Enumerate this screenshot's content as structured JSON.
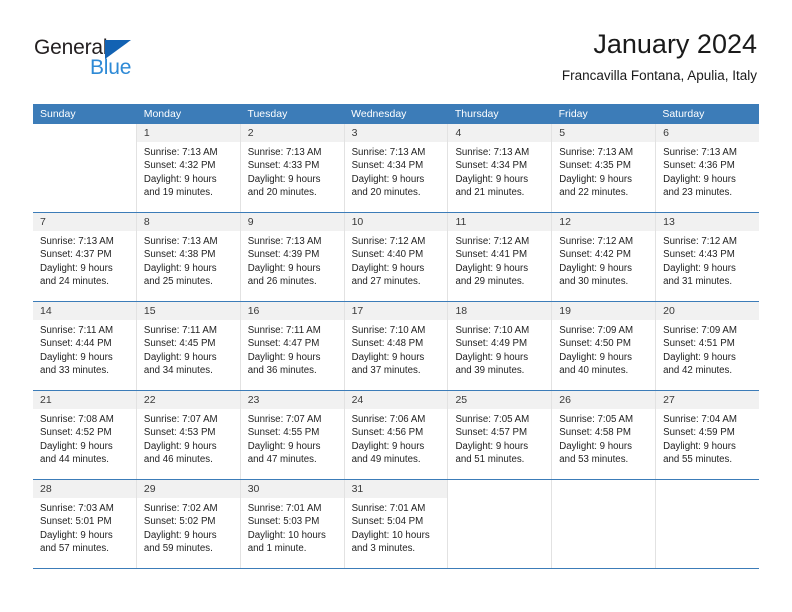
{
  "brand": {
    "name_part1": "General",
    "name_part2": "Blue",
    "triangle_color": "#1262b3",
    "blue_color": "#2e8ad6",
    "dark_color": "#231f20"
  },
  "header": {
    "title": "January 2024",
    "subtitle": "Francavilla Fontana, Apulia, Italy"
  },
  "theme": {
    "header_bar_color": "#3c7cb8",
    "daynum_band_color": "#f1f1f1",
    "cell_border_color": "#e2e2e2"
  },
  "weekdays": [
    "Sunday",
    "Monday",
    "Tuesday",
    "Wednesday",
    "Thursday",
    "Friday",
    "Saturday"
  ],
  "weeks": [
    [
      {
        "day": "",
        "sunrise": "",
        "sunset": "",
        "daylight1": "",
        "daylight2": ""
      },
      {
        "day": "1",
        "sunrise": "Sunrise: 7:13 AM",
        "sunset": "Sunset: 4:32 PM",
        "daylight1": "Daylight: 9 hours",
        "daylight2": "and 19 minutes."
      },
      {
        "day": "2",
        "sunrise": "Sunrise: 7:13 AM",
        "sunset": "Sunset: 4:33 PM",
        "daylight1": "Daylight: 9 hours",
        "daylight2": "and 20 minutes."
      },
      {
        "day": "3",
        "sunrise": "Sunrise: 7:13 AM",
        "sunset": "Sunset: 4:34 PM",
        "daylight1": "Daylight: 9 hours",
        "daylight2": "and 20 minutes."
      },
      {
        "day": "4",
        "sunrise": "Sunrise: 7:13 AM",
        "sunset": "Sunset: 4:34 PM",
        "daylight1": "Daylight: 9 hours",
        "daylight2": "and 21 minutes."
      },
      {
        "day": "5",
        "sunrise": "Sunrise: 7:13 AM",
        "sunset": "Sunset: 4:35 PM",
        "daylight1": "Daylight: 9 hours",
        "daylight2": "and 22 minutes."
      },
      {
        "day": "6",
        "sunrise": "Sunrise: 7:13 AM",
        "sunset": "Sunset: 4:36 PM",
        "daylight1": "Daylight: 9 hours",
        "daylight2": "and 23 minutes."
      }
    ],
    [
      {
        "day": "7",
        "sunrise": "Sunrise: 7:13 AM",
        "sunset": "Sunset: 4:37 PM",
        "daylight1": "Daylight: 9 hours",
        "daylight2": "and 24 minutes."
      },
      {
        "day": "8",
        "sunrise": "Sunrise: 7:13 AM",
        "sunset": "Sunset: 4:38 PM",
        "daylight1": "Daylight: 9 hours",
        "daylight2": "and 25 minutes."
      },
      {
        "day": "9",
        "sunrise": "Sunrise: 7:13 AM",
        "sunset": "Sunset: 4:39 PM",
        "daylight1": "Daylight: 9 hours",
        "daylight2": "and 26 minutes."
      },
      {
        "day": "10",
        "sunrise": "Sunrise: 7:12 AM",
        "sunset": "Sunset: 4:40 PM",
        "daylight1": "Daylight: 9 hours",
        "daylight2": "and 27 minutes."
      },
      {
        "day": "11",
        "sunrise": "Sunrise: 7:12 AM",
        "sunset": "Sunset: 4:41 PM",
        "daylight1": "Daylight: 9 hours",
        "daylight2": "and 29 minutes."
      },
      {
        "day": "12",
        "sunrise": "Sunrise: 7:12 AM",
        "sunset": "Sunset: 4:42 PM",
        "daylight1": "Daylight: 9 hours",
        "daylight2": "and 30 minutes."
      },
      {
        "day": "13",
        "sunrise": "Sunrise: 7:12 AM",
        "sunset": "Sunset: 4:43 PM",
        "daylight1": "Daylight: 9 hours",
        "daylight2": "and 31 minutes."
      }
    ],
    [
      {
        "day": "14",
        "sunrise": "Sunrise: 7:11 AM",
        "sunset": "Sunset: 4:44 PM",
        "daylight1": "Daylight: 9 hours",
        "daylight2": "and 33 minutes."
      },
      {
        "day": "15",
        "sunrise": "Sunrise: 7:11 AM",
        "sunset": "Sunset: 4:45 PM",
        "daylight1": "Daylight: 9 hours",
        "daylight2": "and 34 minutes."
      },
      {
        "day": "16",
        "sunrise": "Sunrise: 7:11 AM",
        "sunset": "Sunset: 4:47 PM",
        "daylight1": "Daylight: 9 hours",
        "daylight2": "and 36 minutes."
      },
      {
        "day": "17",
        "sunrise": "Sunrise: 7:10 AM",
        "sunset": "Sunset: 4:48 PM",
        "daylight1": "Daylight: 9 hours",
        "daylight2": "and 37 minutes."
      },
      {
        "day": "18",
        "sunrise": "Sunrise: 7:10 AM",
        "sunset": "Sunset: 4:49 PM",
        "daylight1": "Daylight: 9 hours",
        "daylight2": "and 39 minutes."
      },
      {
        "day": "19",
        "sunrise": "Sunrise: 7:09 AM",
        "sunset": "Sunset: 4:50 PM",
        "daylight1": "Daylight: 9 hours",
        "daylight2": "and 40 minutes."
      },
      {
        "day": "20",
        "sunrise": "Sunrise: 7:09 AM",
        "sunset": "Sunset: 4:51 PM",
        "daylight1": "Daylight: 9 hours",
        "daylight2": "and 42 minutes."
      }
    ],
    [
      {
        "day": "21",
        "sunrise": "Sunrise: 7:08 AM",
        "sunset": "Sunset: 4:52 PM",
        "daylight1": "Daylight: 9 hours",
        "daylight2": "and 44 minutes."
      },
      {
        "day": "22",
        "sunrise": "Sunrise: 7:07 AM",
        "sunset": "Sunset: 4:53 PM",
        "daylight1": "Daylight: 9 hours",
        "daylight2": "and 46 minutes."
      },
      {
        "day": "23",
        "sunrise": "Sunrise: 7:07 AM",
        "sunset": "Sunset: 4:55 PM",
        "daylight1": "Daylight: 9 hours",
        "daylight2": "and 47 minutes."
      },
      {
        "day": "24",
        "sunrise": "Sunrise: 7:06 AM",
        "sunset": "Sunset: 4:56 PM",
        "daylight1": "Daylight: 9 hours",
        "daylight2": "and 49 minutes."
      },
      {
        "day": "25",
        "sunrise": "Sunrise: 7:05 AM",
        "sunset": "Sunset: 4:57 PM",
        "daylight1": "Daylight: 9 hours",
        "daylight2": "and 51 minutes."
      },
      {
        "day": "26",
        "sunrise": "Sunrise: 7:05 AM",
        "sunset": "Sunset: 4:58 PM",
        "daylight1": "Daylight: 9 hours",
        "daylight2": "and 53 minutes."
      },
      {
        "day": "27",
        "sunrise": "Sunrise: 7:04 AM",
        "sunset": "Sunset: 4:59 PM",
        "daylight1": "Daylight: 9 hours",
        "daylight2": "and 55 minutes."
      }
    ],
    [
      {
        "day": "28",
        "sunrise": "Sunrise: 7:03 AM",
        "sunset": "Sunset: 5:01 PM",
        "daylight1": "Daylight: 9 hours",
        "daylight2": "and 57 minutes."
      },
      {
        "day": "29",
        "sunrise": "Sunrise: 7:02 AM",
        "sunset": "Sunset: 5:02 PM",
        "daylight1": "Daylight: 9 hours",
        "daylight2": "and 59 minutes."
      },
      {
        "day": "30",
        "sunrise": "Sunrise: 7:01 AM",
        "sunset": "Sunset: 5:03 PM",
        "daylight1": "Daylight: 10 hours",
        "daylight2": "and 1 minute."
      },
      {
        "day": "31",
        "sunrise": "Sunrise: 7:01 AM",
        "sunset": "Sunset: 5:04 PM",
        "daylight1": "Daylight: 10 hours",
        "daylight2": "and 3 minutes."
      },
      {
        "day": "",
        "sunrise": "",
        "sunset": "",
        "daylight1": "",
        "daylight2": ""
      },
      {
        "day": "",
        "sunrise": "",
        "sunset": "",
        "daylight1": "",
        "daylight2": ""
      },
      {
        "day": "",
        "sunrise": "",
        "sunset": "",
        "daylight1": "",
        "daylight2": ""
      }
    ]
  ]
}
